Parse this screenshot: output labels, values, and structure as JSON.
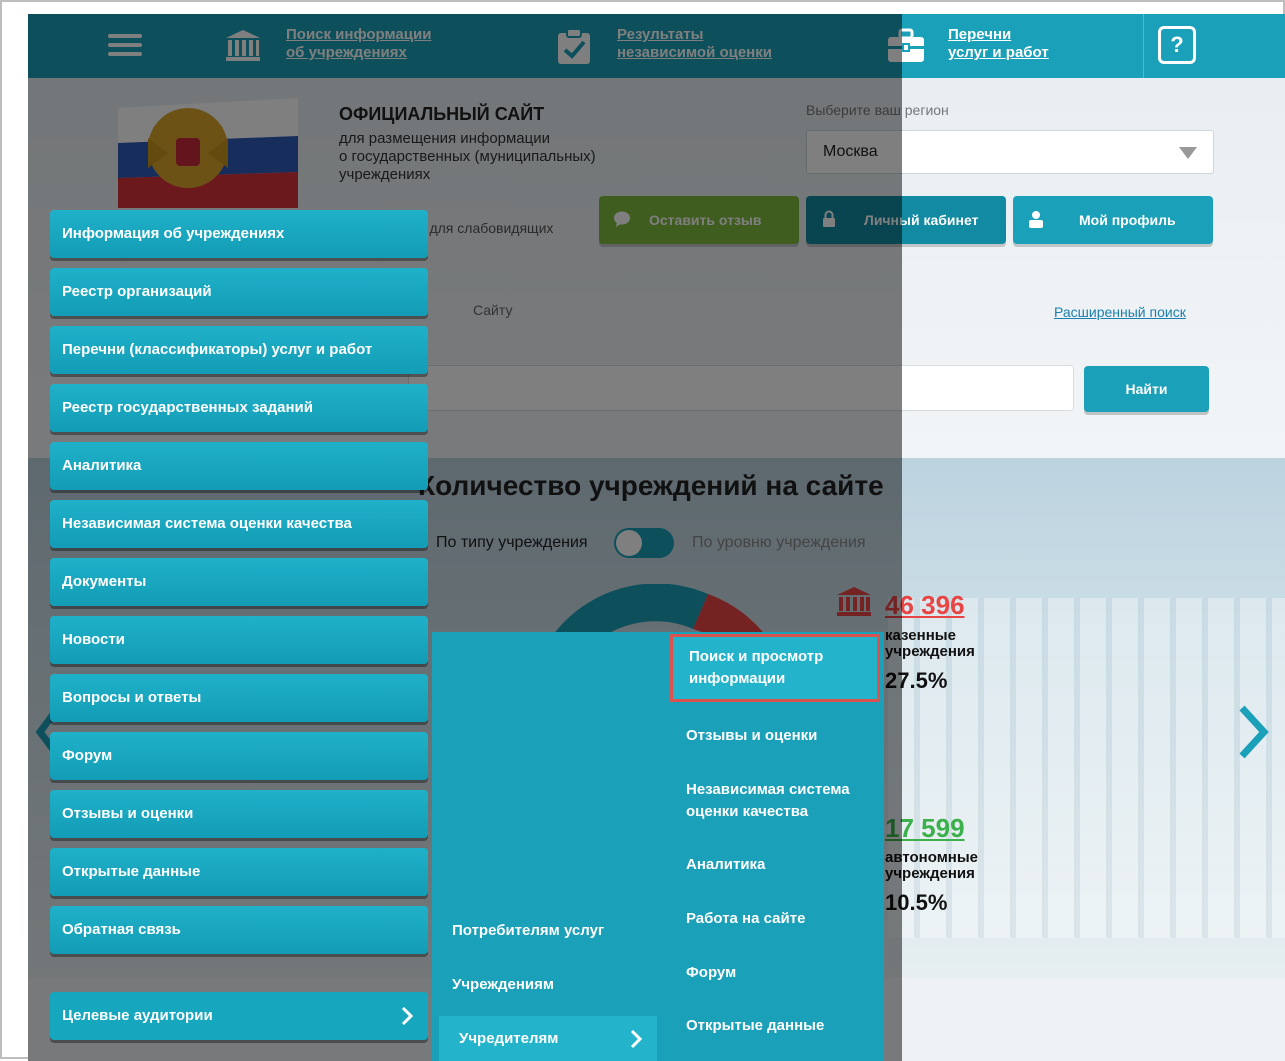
{
  "topbar": {
    "menu_icon": "hamburger-icon",
    "links": [
      {
        "line1": "Поиск информации",
        "line2": "об учреждениях",
        "icon": "bank-icon"
      },
      {
        "line1": "Результаты",
        "line2": "независимой оценки",
        "icon": "checklist-icon"
      },
      {
        "line1": "Перечни",
        "line2": "услуг и работ",
        "icon": "briefcase-icon"
      }
    ],
    "help_label": "?"
  },
  "header": {
    "title": "ОФИЦИАЛЬНЫЙ САЙТ",
    "subtitle_1": "для размещения информации",
    "subtitle_2": "о государственных (муниципальных)",
    "subtitle_3": "учреждениях",
    "region_label": "Выберите ваш регион",
    "region_value": "Москва",
    "low_vision": "я для слабовидящих",
    "feedback_btn": "Оставить отзыв",
    "cabinet_btn": "Личный кабинет",
    "profile_btn": "Мой профиль",
    "site_filter": "Сайту",
    "advanced_search": "Расширенный поиск",
    "search_btn": "Найти"
  },
  "stats": {
    "title": "Количество учреждений на сайте",
    "toggle_left": "По типу учреждения",
    "toggle_right": "По уровню учреждения",
    "items": [
      {
        "number": "46 396",
        "label_1": "казенные",
        "label_2": "учреждения",
        "percent": "27.5%",
        "color": "#e84545"
      },
      {
        "number": "17 599",
        "label_1": "автономные",
        "label_2": "учреждения",
        "percent": "10.5%",
        "color": "#3bb04b"
      }
    ]
  },
  "menu": {
    "items": [
      "Информация об учреждениях",
      "Реестр организаций",
      "Перечни (классификаторы) услуг и работ",
      "Реестр государственных заданий",
      "Аналитика",
      "Независимая система оценки качества",
      "Документы",
      "Новости",
      "Вопросы и ответы",
      "Форум",
      "Отзывы и оценки",
      "Открытые данные",
      "Обратная связь"
    ],
    "target_audiences": "Целевые аудитории"
  },
  "submenu": {
    "audiences": [
      "Потребителям услуг",
      "Учреждениям",
      "Учредителям"
    ],
    "founder_items": [
      "Поиск и просмотр информации",
      "Отзывы и оценки",
      "Независимая система оценки качества",
      "Аналитика",
      "Работа на сайте",
      "Форум",
      "Открытые данные"
    ]
  },
  "colors": {
    "brand": "#1aa0b8",
    "feedback_green": "#7dbb3c",
    "highlight_border": "#d9534f"
  }
}
